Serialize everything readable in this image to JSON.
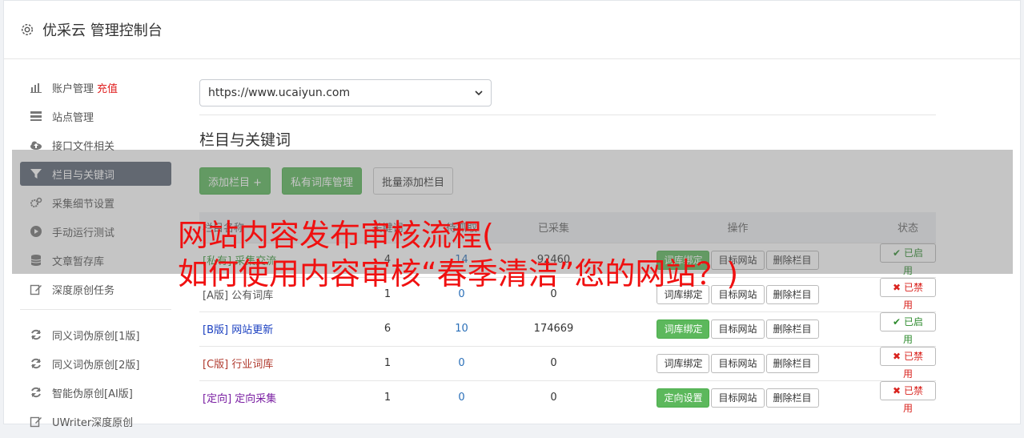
{
  "header": {
    "title": "优采云 管理控制台",
    "icon": "gear-icon"
  },
  "sidebar": {
    "items": [
      {
        "label": "账户管理",
        "extra": "充值",
        "icon": "bar-chart-icon"
      },
      {
        "label": "站点管理",
        "icon": "server-icon"
      },
      {
        "label": "接口文件相关",
        "icon": "cloud-upload-icon"
      },
      {
        "label": "栏目与关键词",
        "icon": "filter-icon",
        "active": true
      },
      {
        "label": "采集细节设置",
        "icon": "gears-icon"
      },
      {
        "label": "手动运行测试",
        "icon": "play-circle-icon"
      },
      {
        "label": "文章暂存库",
        "icon": "database-icon"
      },
      {
        "label": "深度原创任务",
        "icon": "edit-icon"
      },
      {
        "label": "同义词伪原创[1版]",
        "icon": "refresh-icon"
      },
      {
        "label": "同义词伪原创[2版]",
        "icon": "refresh-icon"
      },
      {
        "label": "智能伪原创[AI版]",
        "icon": "refresh-icon"
      },
      {
        "label": "UWriter深度原创",
        "icon": "edit-icon"
      }
    ]
  },
  "site_select": {
    "value": "https://www.ucaiyun.com"
  },
  "section": {
    "title": "栏目与关键词"
  },
  "buttons": {
    "add_column": "添加栏目 +",
    "private_lib": "私有词库管理",
    "batch_add": "批量添加栏目"
  },
  "table": {
    "headers": [
      "栏目名称",
      "关键词",
      "待抓取",
      "已采集",
      "操作",
      "状态"
    ],
    "rows": [
      {
        "tag": "[私有]",
        "name": "采集交流",
        "kw": "4",
        "pending": "14",
        "collected": "92460",
        "op1": "词库绑定",
        "op1_green": true,
        "op2": "目标网站",
        "op3": "删除栏目",
        "status": "已启用",
        "on": true,
        "tagclass": "tag-priv"
      },
      {
        "tag": "[A版]",
        "name": "公有词库",
        "kw": "1",
        "pending": "0",
        "collected": "0",
        "op1": "词库绑定",
        "op1_green": false,
        "op2": "目标网站",
        "op3": "删除栏目",
        "status": "已禁用",
        "on": false,
        "tagclass": "tag-a"
      },
      {
        "tag": "[B版]",
        "name": "网站更新",
        "kw": "6",
        "pending": "10",
        "collected": "174669",
        "op1": "词库绑定",
        "op1_green": true,
        "op2": "目标网站",
        "op3": "删除栏目",
        "status": "已启用",
        "on": true,
        "tagclass": "tag-b"
      },
      {
        "tag": "[C版]",
        "name": "行业词库",
        "kw": "1",
        "pending": "0",
        "collected": "0",
        "op1": "词库绑定",
        "op1_green": false,
        "op2": "目标网站",
        "op3": "删除栏目",
        "status": "已禁用",
        "on": false,
        "tagclass": "tag-c"
      },
      {
        "tag": "[定向]",
        "name": "定向采集",
        "kw": "1",
        "pending": "0",
        "collected": "0",
        "op1": "定向设置",
        "op1_green": true,
        "op2": "目标网站",
        "op3": "删除栏目",
        "status": "已禁用",
        "on": false,
        "tagclass": "tag-d"
      }
    ]
  },
  "banner": {
    "line1": "网站内容发布审核流程(",
    "line2": "如何使用内容审核“春季清洁”您的网站？)"
  },
  "colors": {
    "accent_green": "#5cb85c",
    "active_nav": "#5a6474",
    "banner_red": "#f01010"
  }
}
